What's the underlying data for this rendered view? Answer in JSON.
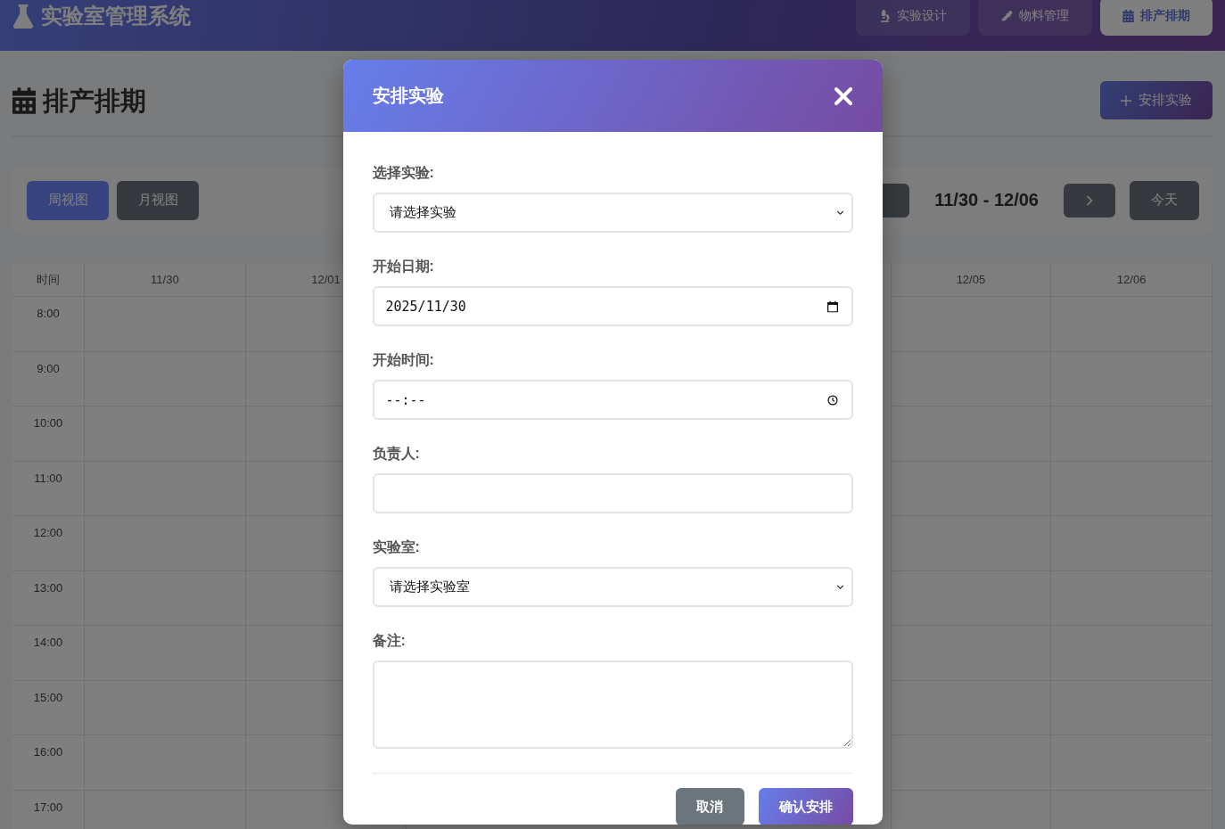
{
  "header": {
    "title": "实验室管理系统",
    "nav": [
      {
        "label": "实验设计",
        "selected": false
      },
      {
        "label": "物料管理",
        "selected": false
      },
      {
        "label": "排产排期",
        "selected": true
      }
    ]
  },
  "page": {
    "title": "排产排期",
    "add_button": "安排实验"
  },
  "toolbar": {
    "views": [
      {
        "label": "周视图",
        "selected": true
      },
      {
        "label": "月视图",
        "selected": false
      }
    ],
    "range": "11/30 - 12/06",
    "today": "今天"
  },
  "calendar": {
    "time_header": "时间",
    "left_days": [
      "11/30",
      "12/01"
    ],
    "right_days": [
      "12/05",
      "12/06"
    ],
    "times": [
      "8:00",
      "9:00",
      "10:00",
      "11:00",
      "12:00",
      "13:00",
      "14:00",
      "15:00",
      "16:00",
      "17:00"
    ]
  },
  "modal": {
    "title": "安排实验",
    "fields": [
      {
        "kind": "select",
        "label": "选择实验:",
        "value": "请选择实验"
      },
      {
        "kind": "date",
        "label": "开始日期:",
        "value": "2025/11/30"
      },
      {
        "kind": "time",
        "label": "开始时间:",
        "placeholder": "--:--"
      },
      {
        "kind": "text",
        "label": "负责人:"
      },
      {
        "kind": "select",
        "label": "实验室:",
        "value": "请选择实验室"
      },
      {
        "kind": "textarea",
        "label": "备注:"
      }
    ],
    "buttons": [
      {
        "kind": "secondary",
        "label": "取消"
      },
      {
        "kind": "primary",
        "label": "确认安排"
      }
    ]
  }
}
